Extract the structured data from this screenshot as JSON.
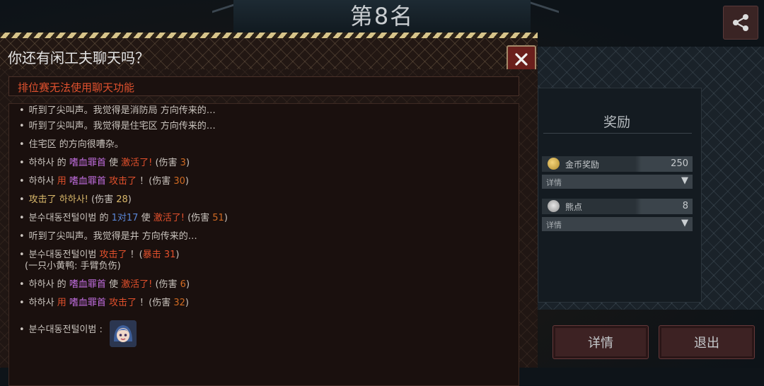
{
  "header": {
    "rank_title": "第8名"
  },
  "dialog": {
    "title": "你还有闲工夫聊天吗？",
    "notice": "排位赛无法使用聊天功能",
    "messages": [
      {
        "parts": [
          {
            "t": "听到了尖叫声。我觉得是消防局 方向传来的…",
            "c": "n"
          }
        ]
      },
      {
        "parts": [
          {
            "t": "听到了尖叫声。我觉得是住宅区 方向传来的…",
            "c": "n"
          }
        ]
      },
      {
        "parts": [
          {
            "t": "住宅区 的方向很嘈杂。",
            "c": "n"
          }
        ]
      },
      {
        "parts": [
          {
            "t": "하하사 的 ",
            "c": "n"
          },
          {
            "t": "嗜血罪首",
            "c": "purple"
          },
          {
            "t": " 使  ",
            "c": "n"
          },
          {
            "t": "激活了!",
            "c": "red"
          },
          {
            "t": " (伤害 ",
            "c": "n"
          },
          {
            "t": "3",
            "c": "orange"
          },
          {
            "t": ")",
            "c": "n"
          }
        ]
      },
      {
        "parts": [
          {
            "t": "하하사  ",
            "c": "n"
          },
          {
            "t": "用 ",
            "c": "red"
          },
          {
            "t": "嗜血罪首",
            "c": "purple"
          },
          {
            "t": " ",
            "c": "n"
          },
          {
            "t": "攻击了",
            "c": "red"
          },
          {
            "t": " ！(伤害 ",
            "c": "n"
          },
          {
            "t": "30",
            "c": "orange"
          },
          {
            "t": ")",
            "c": "n"
          }
        ]
      },
      {
        "parts": [
          {
            "t": "攻击了 하하사!",
            "c": "gold"
          },
          {
            "t": " (伤害 ",
            "c": "n"
          },
          {
            "t": "28",
            "c": "gold"
          },
          {
            "t": ")",
            "c": "n"
          }
        ]
      },
      {
        "parts": [
          {
            "t": "분수대동전털이범 的 ",
            "c": "n"
          },
          {
            "t": "1对17",
            "c": "blue"
          },
          {
            "t": " 使  ",
            "c": "n"
          },
          {
            "t": "激活了!",
            "c": "red"
          },
          {
            "t": " (伤害 ",
            "c": "n"
          },
          {
            "t": "51",
            "c": "orange"
          },
          {
            "t": ")",
            "c": "n"
          }
        ]
      },
      {
        "parts": [
          {
            "t": "听到了尖叫声。我觉得是井 方向传来的…",
            "c": "n"
          }
        ]
      },
      {
        "parts": [
          {
            "t": "분수대동전털이범  ",
            "c": "n"
          },
          {
            "t": "攻击了",
            "c": "red"
          },
          {
            "t": " ！(",
            "c": "n"
          },
          {
            "t": "暴击 31",
            "c": "red"
          },
          {
            "t": ")",
            "c": "n"
          }
        ]
      },
      {
        "parts": [
          {
            "t": "(一只小黄鸭: 手臂负伤)",
            "c": "n"
          }
        ]
      },
      {
        "parts": [
          {
            "t": "하하사 的 ",
            "c": "n"
          },
          {
            "t": "嗜血罪首",
            "c": "purple"
          },
          {
            "t": " 使  ",
            "c": "n"
          },
          {
            "t": "激活了!",
            "c": "red"
          },
          {
            "t": " (伤害 ",
            "c": "n"
          },
          {
            "t": "6",
            "c": "orange"
          },
          {
            "t": ")",
            "c": "n"
          }
        ]
      },
      {
        "parts": [
          {
            "t": "하하사  ",
            "c": "n"
          },
          {
            "t": "用 ",
            "c": "red"
          },
          {
            "t": "嗜血罪首",
            "c": "purple"
          },
          {
            "t": " ",
            "c": "n"
          },
          {
            "t": "攻击了",
            "c": "red"
          },
          {
            "t": " ！(伤害 ",
            "c": "n"
          },
          {
            "t": "32",
            "c": "orange"
          },
          {
            "t": ")",
            "c": "n"
          }
        ]
      },
      {
        "parts": [
          {
            "t": "분수대동전털이범 :",
            "c": "n"
          }
        ]
      }
    ]
  },
  "rewards": {
    "title": "奖励",
    "gold": {
      "label": "金币奖励",
      "value": "250",
      "detail": "详情"
    },
    "bear": {
      "label": "熊点",
      "value": "8",
      "detail": "详情"
    }
  },
  "buttons": {
    "detail": "详情",
    "exit": "退出"
  },
  "colors": {
    "notice_red": "#e0512e",
    "weapon_purple": "#c26ee0",
    "damage_orange": "#d06a22",
    "hazard_yellow": "#d7c48a"
  }
}
